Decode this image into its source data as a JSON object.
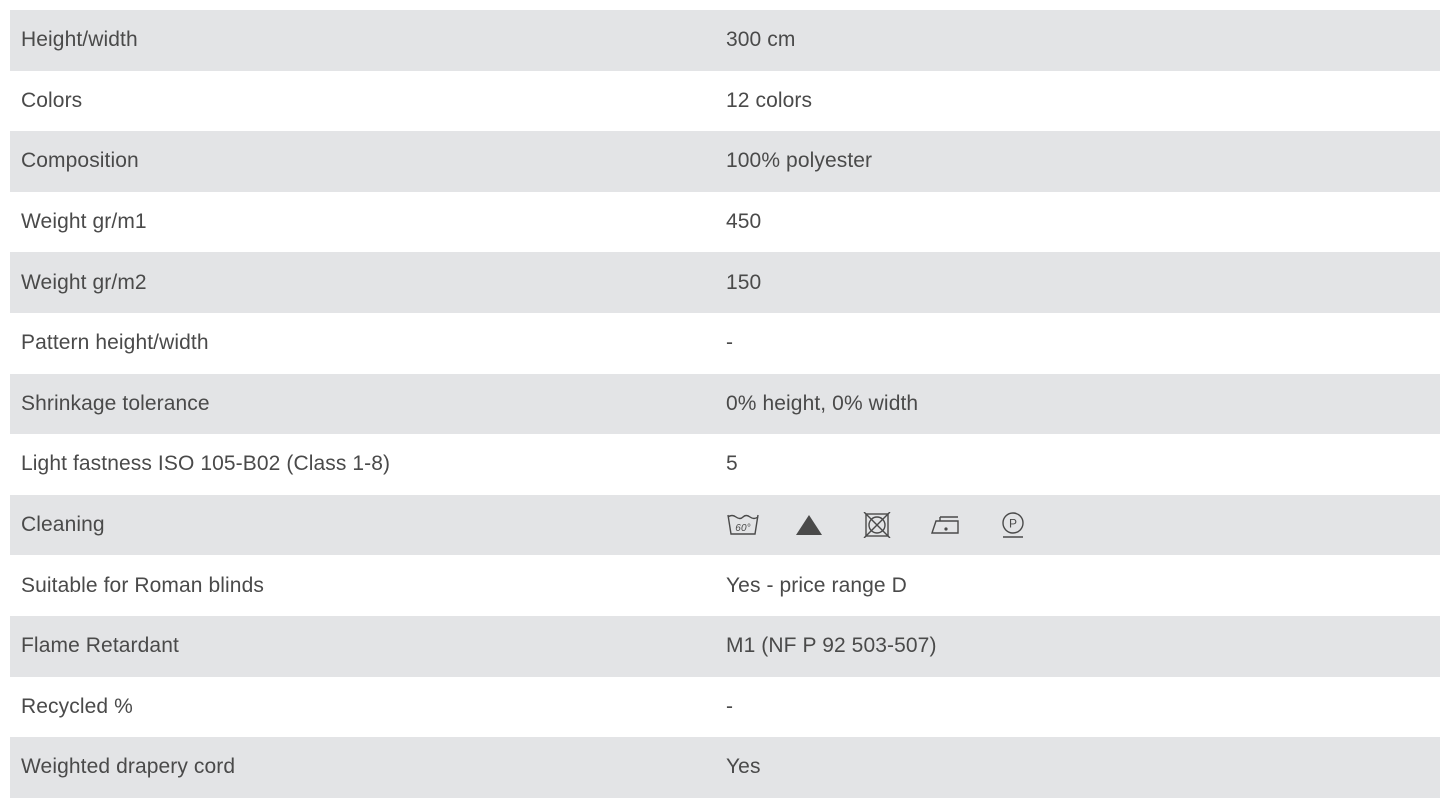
{
  "specs": [
    {
      "label": "Height/width",
      "value": "300 cm"
    },
    {
      "label": "Colors",
      "value": "12 colors"
    },
    {
      "label": "Composition",
      "value": "100% polyester"
    },
    {
      "label": "Weight gr/m1",
      "value": "450"
    },
    {
      "label": "Weight gr/m2",
      "value": "150"
    },
    {
      "label": "Pattern height/width",
      "value": "-"
    },
    {
      "label": "Shrinkage tolerance",
      "value": "0% height, 0% width"
    },
    {
      "label": "Light fastness ISO 105-B02 (Class 1-8)",
      "value": "5"
    },
    {
      "label": "Cleaning",
      "icons": [
        "wash-60-icon",
        "bleach-allowed-icon",
        "no-tumble-dry-icon",
        "iron-low-icon",
        "dry-clean-p-icon"
      ],
      "wash_temp": "60°",
      "dry_clean_letter": "P"
    },
    {
      "label": "Suitable for Roman blinds",
      "value": "Yes - price range D"
    },
    {
      "label": "Flame Retardant",
      "value": "M1 (NF P 92 503-507)"
    },
    {
      "label": "Recycled %",
      "value": "-"
    },
    {
      "label": "Weighted drapery cord",
      "value": "Yes"
    }
  ],
  "colors": {
    "row_shade": "#e3e4e6",
    "text": "#4a4a4a"
  }
}
